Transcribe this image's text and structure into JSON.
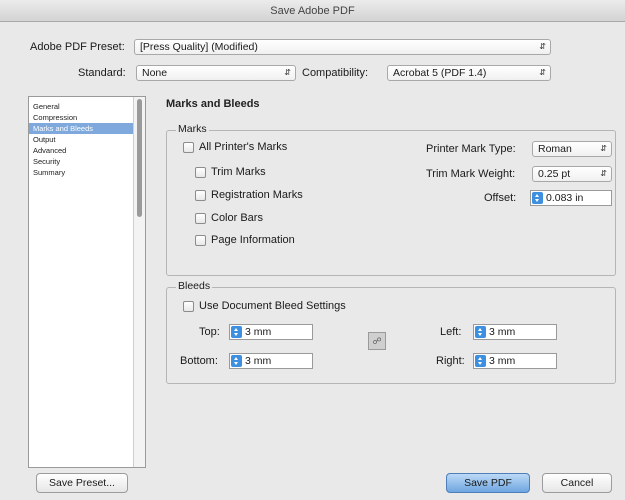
{
  "window": {
    "title": "Save Adobe PDF"
  },
  "preset": {
    "label": "Adobe PDF Preset:",
    "value": "[Press Quality] (Modified)"
  },
  "standard": {
    "label": "Standard:",
    "value": "None"
  },
  "compatibility": {
    "label": "Compatibility:",
    "value": "Acrobat 5 (PDF 1.4)"
  },
  "sidebar": {
    "items": [
      {
        "label": "General"
      },
      {
        "label": "Compression"
      },
      {
        "label": "Marks and Bleeds"
      },
      {
        "label": "Output"
      },
      {
        "label": "Advanced"
      },
      {
        "label": "Security"
      },
      {
        "label": "Summary"
      }
    ],
    "selected_index": 2
  },
  "panel": {
    "title": "Marks and Bleeds"
  },
  "marks": {
    "legend": "Marks",
    "all_printers_marks": "All Printer's Marks",
    "trim_marks": "Trim Marks",
    "registration_marks": "Registration Marks",
    "color_bars": "Color Bars",
    "page_information": "Page Information",
    "printer_mark_type_label": "Printer Mark Type:",
    "printer_mark_type_value": "Roman",
    "trim_mark_weight_label": "Trim Mark Weight:",
    "trim_mark_weight_value": "0.25 pt",
    "offset_label": "Offset:",
    "offset_value": "0.083 in"
  },
  "bleeds": {
    "legend": "Bleeds",
    "use_document_bleed": "Use Document Bleed Settings",
    "top_label": "Top:",
    "top_value": "3 mm",
    "bottom_label": "Bottom:",
    "bottom_value": "3 mm",
    "left_label": "Left:",
    "left_value": "3 mm",
    "right_label": "Right:",
    "right_value": "3 mm"
  },
  "buttons": {
    "save_preset": "Save Preset...",
    "save_pdf": "Save PDF",
    "cancel": "Cancel"
  },
  "colors": {
    "accent": "#3d8fe0",
    "selection": "#7fa9dc"
  }
}
